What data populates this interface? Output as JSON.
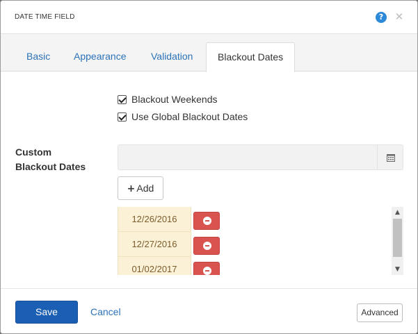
{
  "dialog": {
    "title": "DATE TIME FIELD",
    "help_icon": "?",
    "close_icon": "✕"
  },
  "tabs": [
    {
      "label": "Basic",
      "active": false
    },
    {
      "label": "Appearance",
      "active": false
    },
    {
      "label": "Validation",
      "active": false
    },
    {
      "label": "Blackout Dates",
      "active": true
    }
  ],
  "options": {
    "blackout_weekends": {
      "label": "Blackout Weekends",
      "checked": true
    },
    "global_blackout": {
      "label": "Use Global Blackout Dates",
      "checked": true
    }
  },
  "custom_dates": {
    "label_line1": "Custom",
    "label_line2": "Blackout Dates",
    "input_value": "",
    "calendar_icon": "calendar-icon",
    "add_label": "Add",
    "dates": [
      "12/26/2016",
      "12/27/2016",
      "01/02/2017"
    ]
  },
  "footer": {
    "save_label": "Save",
    "cancel_label": "Cancel",
    "advanced_label": "Advanced"
  },
  "colors": {
    "accent": "#1a5fb4",
    "link": "#2b72b8",
    "danger": "#d9534f",
    "date_highlight": "#fbf1d6"
  }
}
